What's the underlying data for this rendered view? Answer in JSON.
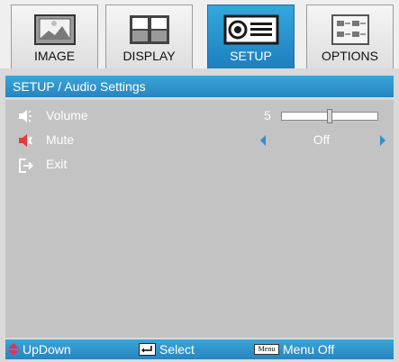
{
  "tabs": [
    {
      "label": "IMAGE",
      "icon": "image-icon",
      "active": false
    },
    {
      "label": "DISPLAY",
      "icon": "display-icon",
      "active": false
    },
    {
      "label": "SETUP",
      "icon": "setup-icon",
      "active": true
    },
    {
      "label": "OPTIONS",
      "icon": "options-icon",
      "active": false
    }
  ],
  "header": {
    "title": "SETUP / Audio Settings"
  },
  "settings": {
    "volume": {
      "label": "Volume",
      "value": "5",
      "level_fraction": 0.5,
      "icon": "speaker-icon"
    },
    "mute": {
      "label": "Mute",
      "value": "Off",
      "icon": "mute-speaker-icon"
    },
    "exit": {
      "label": "Exit",
      "icon": "exit-icon"
    }
  },
  "footer": {
    "updown_label": "UpDown",
    "select_label": "Select",
    "menu_key_label": "Menu",
    "menu_off_label": "Menu Off"
  },
  "colors": {
    "accent_blue": "#2f8fd3",
    "panel_gray": "#c3c3c3",
    "mute_red": "#e23b3b",
    "updown_red": "#e6305a"
  }
}
